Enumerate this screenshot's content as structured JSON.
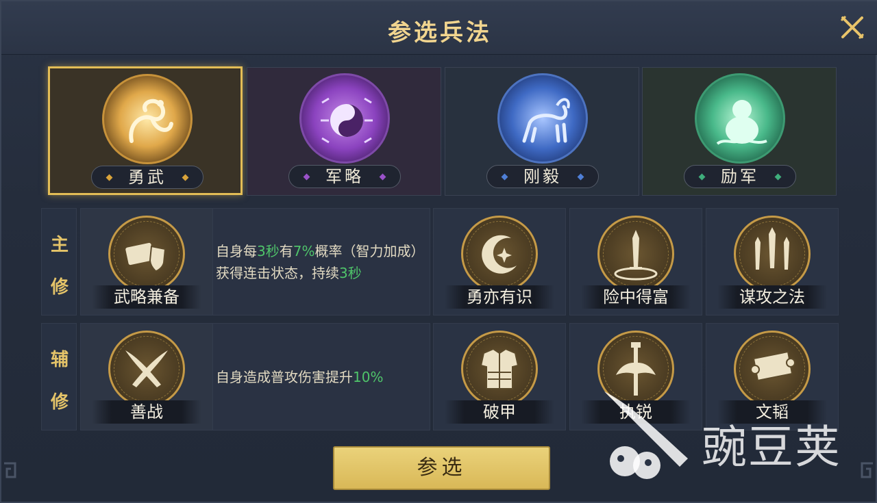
{
  "window": {
    "title": "参选兵法"
  },
  "categories": [
    {
      "label": "勇武",
      "color": "#d9a33a",
      "selected": true,
      "icon": "dragon-icon"
    },
    {
      "label": "军略",
      "color": "#9a52c9",
      "selected": false,
      "icon": "taiji-icon"
    },
    {
      "label": "刚毅",
      "color": "#4f7fd6",
      "selected": false,
      "icon": "qilin-icon"
    },
    {
      "label": "励军",
      "color": "#3fae7c",
      "selected": false,
      "icon": "gourd-icon"
    }
  ],
  "main": {
    "row_label": [
      "主",
      "修"
    ],
    "current": {
      "name": "武略兼备",
      "icon": "scroll-shield-icon"
    },
    "desc_parts": [
      "自身每",
      "3秒",
      "有",
      "7%",
      "概率（智力加成）获得连击状态，持续",
      "3秒"
    ],
    "options": [
      {
        "name": "勇亦有识",
        "icon": "crescent-star-icon"
      },
      {
        "name": "险中得富",
        "icon": "sword-ring-icon"
      },
      {
        "name": "谋攻之法",
        "icon": "three-swords-icon"
      }
    ]
  },
  "sub": {
    "row_label": [
      "辅",
      "修"
    ],
    "current": {
      "name": "善战",
      "icon": "crossed-blades-icon"
    },
    "desc_parts": [
      "自身造成普攻伤害提升",
      "10%"
    ],
    "options": [
      {
        "name": "破甲",
        "icon": "armor-icon"
      },
      {
        "name": "执锐",
        "icon": "halberd-icon"
      },
      {
        "name": "文韬",
        "icon": "scroll-icon"
      }
    ]
  },
  "confirm_label": "参选",
  "watermark": {
    "text": "豌豆荚"
  }
}
